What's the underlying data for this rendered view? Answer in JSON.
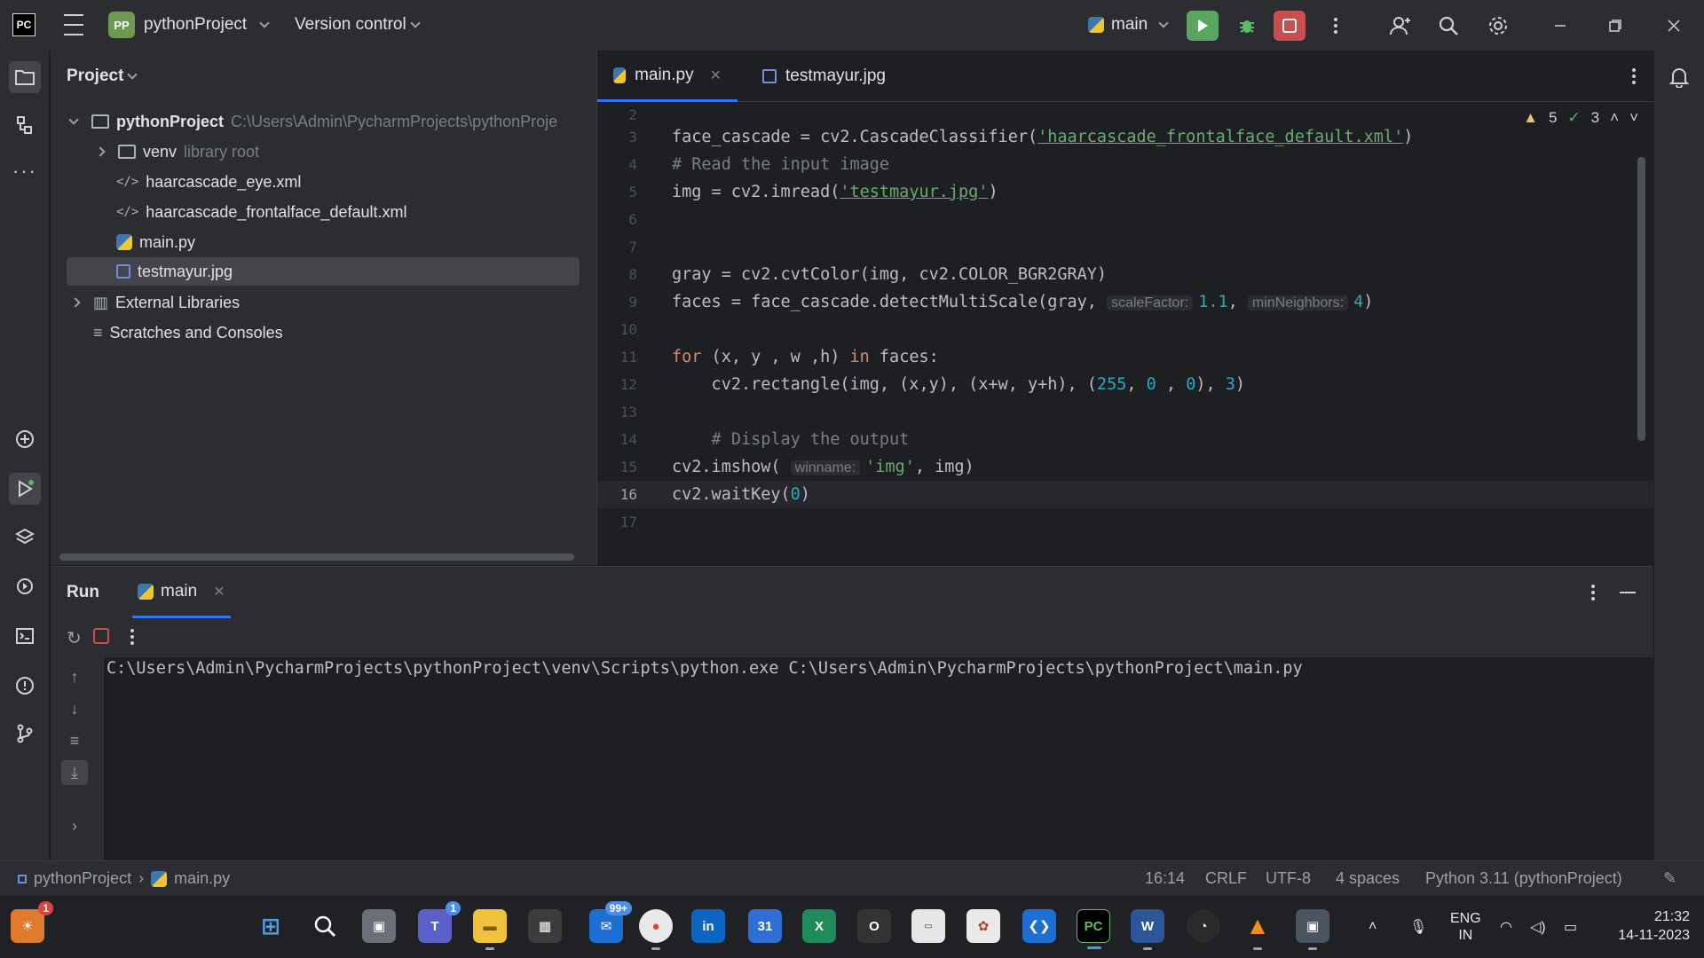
{
  "titlebar": {
    "logo": "PC",
    "project_badge": "PP",
    "project_name": "pythonProject",
    "version_control": "Version control",
    "run_config": "main"
  },
  "project_panel": {
    "title": "Project",
    "root_name": "pythonProject",
    "root_path": "C:\\Users\\Admin\\PycharmProjects\\pythonProje",
    "venv_name": "venv",
    "venv_hint": "library root",
    "files": [
      "haarcascade_eye.xml",
      "haarcascade_frontalface_default.xml",
      "main.py",
      "testmayur.jpg"
    ],
    "external_libraries": "External Libraries",
    "scratches": "Scratches and Consoles"
  },
  "editor": {
    "tabs": [
      "main.py",
      "testmayur.jpg"
    ],
    "warnings_count": "5",
    "weak_warnings_count": "3",
    "line_numbers": [
      "2",
      "3",
      "4",
      "5",
      "6",
      "7",
      "8",
      "9",
      "10",
      "11",
      "12",
      "13",
      "14",
      "15",
      "16",
      "17"
    ],
    "code": {
      "l3_pre": "face_cascade = cv2.CascadeClassifier(",
      "l3_str": "'haarcascade_frontalface_default.xml'",
      "l3_post": ")",
      "l4": "# Read the input image",
      "l5_pre": "img = cv2.imread(",
      "l5_str": "'testmayur.jpg'",
      "l5_post": ")",
      "l8": "gray = cv2.cvtColor(img, cv2.COLOR_BGR2GRAY)",
      "l9_pre": "faces = face_cascade.detectMultiScale(gray, ",
      "l9_hint1": "scaleFactor:",
      "l9_val1": "1.1",
      "l9_sep": ", ",
      "l9_hint2": "minNeighbors:",
      "l9_val2": "4",
      "l9_post": ")",
      "l11_kw1": "for",
      "l11_mid": " (x, y , w ,h) ",
      "l11_kw2": "in",
      "l11_post": " faces:",
      "l12_pre": "    cv2.rectangle(img, (x,y), (x+w, y+h), (",
      "l12_n1": "255",
      "l12_c1": ", ",
      "l12_n2": "0",
      "l12_c2": " , ",
      "l12_n3": "0",
      "l12_c3": "), ",
      "l12_n4": "3",
      "l12_post": ")",
      "l14": "    # Display the output",
      "l15_pre": "cv2.imshow( ",
      "l15_hint": "winname:",
      "l15_str": "'img'",
      "l15_post": ", img)",
      "l16_pre": "cv2.waitKey(",
      "l16_num": "0",
      "l16_post": ")"
    }
  },
  "run_panel": {
    "title": "Run",
    "tab": "main",
    "console": "C:\\Users\\Admin\\PycharmProjects\\pythonProject\\venv\\Scripts\\python.exe C:\\Users\\Admin\\PycharmProjects\\pythonProject\\main.py"
  },
  "statusbar": {
    "breadcrumb_project": "pythonProject",
    "breadcrumb_file": "main.py",
    "position": "16:14",
    "line_sep": "CRLF",
    "encoding": "UTF-8",
    "indent": "4 spaces",
    "interpreter": "Python 3.11 (pythonProject)"
  },
  "taskbar": {
    "widget_badge": "1",
    "teams_badge": "1",
    "mail_badge": "99+",
    "calendar_day": "31",
    "lang": "ENG",
    "region": "IN",
    "time": "21:32",
    "date": "14-11-2023"
  },
  "colors": {
    "accent": "#3574f0",
    "run_green": "#5aa661",
    "stop_red": "#c94f4f",
    "string_green": "#6aab73",
    "keyword_orange": "#cf8e6d",
    "number_cyan": "#2aacb8"
  }
}
